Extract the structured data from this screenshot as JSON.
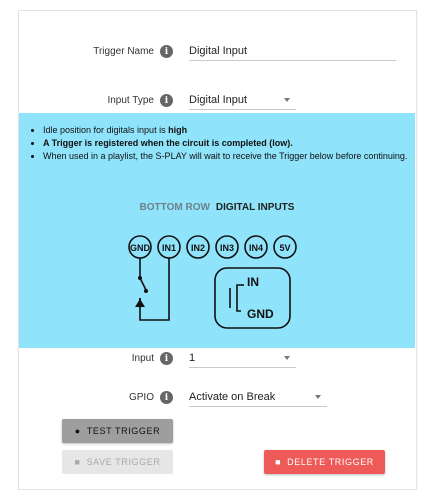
{
  "form": {
    "trigger_name_label": "Trigger Name",
    "trigger_name_value": "Digital Input",
    "input_type_label": "Input Type",
    "input_type_value": "Digital Input",
    "input_label": "Input",
    "input_value": "1",
    "gpio_label": "GPIO",
    "gpio_value": "Activate on Break"
  },
  "info": {
    "bullet1_prefix": "Idle position for digitals input is ",
    "bullet1_bold": "high",
    "bullet2": "A Trigger is registered when the circuit is completed (low).",
    "bullet3": "When used in a playlist, the S-PLAY will wait to receive the Trigger below before continuing."
  },
  "diagram": {
    "title_gray": "BOTTOM ROW",
    "title_dark": "DIGITAL INPUTS",
    "pins": [
      "GND",
      "IN1",
      "IN2",
      "IN3",
      "IN4",
      "5V"
    ],
    "symbol_in": "IN",
    "symbol_gnd": "GND"
  },
  "buttons": {
    "test": "TEST TRIGGER",
    "save": "SAVE TRIGGER",
    "delete": "DELETE TRIGGER"
  },
  "colors": {
    "info_panel": "#8fe3fa",
    "delete_button": "#ee5a58",
    "test_button": "#9e9e9e",
    "save_button_disabled": "#e6e6e6"
  }
}
